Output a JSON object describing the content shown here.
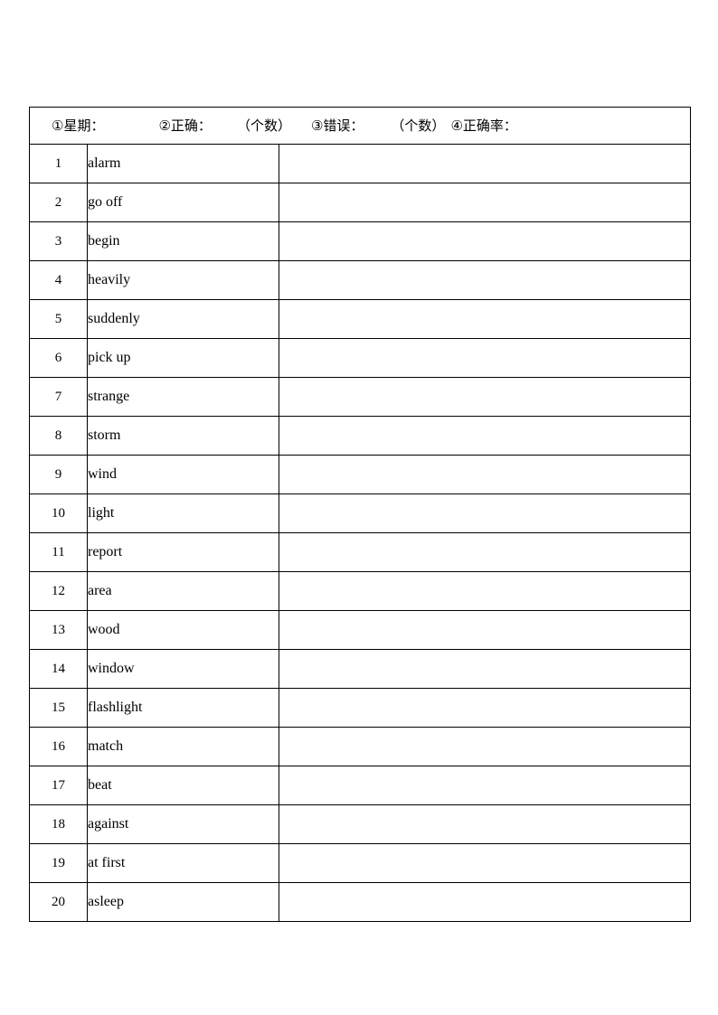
{
  "document": {
    "type": "vocabulary-practice-table",
    "header": {
      "segments": [
        {
          "marker": "①",
          "label": "星期："
        },
        {
          "marker": "②",
          "label": "正确："
        },
        {
          "marker": "",
          "label": "（个数）"
        },
        {
          "marker": "③",
          "label": "错误："
        },
        {
          "marker": "",
          "label": "（个数）"
        },
        {
          "marker": "④",
          "label": "正确率："
        }
      ],
      "full_text": "①星期：        ②正确：      （个数）   ③错误：     （个数）  ④正确率："
    },
    "columns": {
      "number": "",
      "word": "",
      "answer": ""
    },
    "rows": [
      {
        "number": "1",
        "word": "alarm",
        "answer": ""
      },
      {
        "number": "2",
        "word": "go off",
        "answer": ""
      },
      {
        "number": "3",
        "word": "begin",
        "answer": ""
      },
      {
        "number": "4",
        "word": "heavily",
        "answer": ""
      },
      {
        "number": "5",
        "word": "suddenly",
        "answer": ""
      },
      {
        "number": "6",
        "word": "pick up",
        "answer": ""
      },
      {
        "number": "7",
        "word": "strange",
        "answer": ""
      },
      {
        "number": "8",
        "word": "storm",
        "answer": ""
      },
      {
        "number": "9",
        "word": "wind",
        "answer": ""
      },
      {
        "number": "10",
        "word": "light",
        "answer": ""
      },
      {
        "number": "11",
        "word": "report",
        "answer": ""
      },
      {
        "number": "12",
        "word": "area",
        "answer": ""
      },
      {
        "number": "13",
        "word": "wood",
        "answer": ""
      },
      {
        "number": "14",
        "word": "window",
        "answer": ""
      },
      {
        "number": "15",
        "word": "flashlight",
        "answer": ""
      },
      {
        "number": "16",
        "word": "match",
        "answer": ""
      },
      {
        "number": "17",
        "word": "beat",
        "answer": ""
      },
      {
        "number": "18",
        "word": "against",
        "answer": ""
      },
      {
        "number": "19",
        "word": "at first",
        "answer": ""
      },
      {
        "number": "20",
        "word": "asleep",
        "answer": ""
      }
    ]
  },
  "colors": {
    "border": "#000000",
    "text": "#000000",
    "background": "#ffffff"
  }
}
